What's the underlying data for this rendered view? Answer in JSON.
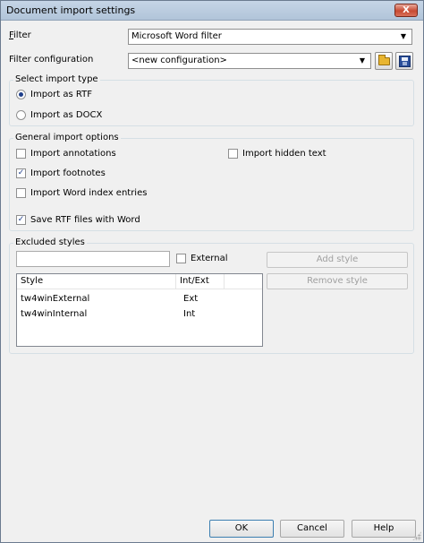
{
  "window": {
    "title": "Document import settings",
    "close_glyph": "X"
  },
  "filter": {
    "label": "Filter",
    "value": "Microsoft Word filter"
  },
  "filter_configuration": {
    "label": "Filter configuration",
    "value": "<new configuration>",
    "open_icon": "folder-open-icon",
    "save_icon": "save-disk-icon"
  },
  "import_type": {
    "group_title": "Select import type",
    "options": [
      {
        "label": "Import as RTF",
        "selected": true
      },
      {
        "label": "Import as DOCX",
        "selected": false
      }
    ]
  },
  "general_options": {
    "group_title": "General import options",
    "import_annotations": {
      "label": "Import annotations",
      "checked": false
    },
    "import_hidden_text": {
      "label": "Import hidden text",
      "checked": false
    },
    "import_footnotes": {
      "label": "Import footnotes",
      "checked": true
    },
    "import_word_index": {
      "label": "Import Word index entries",
      "checked": false
    },
    "save_rtf": {
      "label": "Save RTF files with Word",
      "checked": true
    }
  },
  "excluded_styles": {
    "group_title": "Excluded styles",
    "input_value": "",
    "external": {
      "label": "External",
      "checked": false
    },
    "add_style_label": "Add style",
    "remove_style_label": "Remove style",
    "columns": [
      "Style",
      "Int/Ext"
    ],
    "rows": [
      {
        "style": "tw4winExternal",
        "type": "Ext"
      },
      {
        "style": "tw4winInternal",
        "type": "Int"
      }
    ]
  },
  "footer": {
    "ok_label": "OK",
    "cancel_label": "Cancel",
    "help_label": "Help"
  },
  "check_glyph": "✓",
  "arrow_glyph": "▼"
}
